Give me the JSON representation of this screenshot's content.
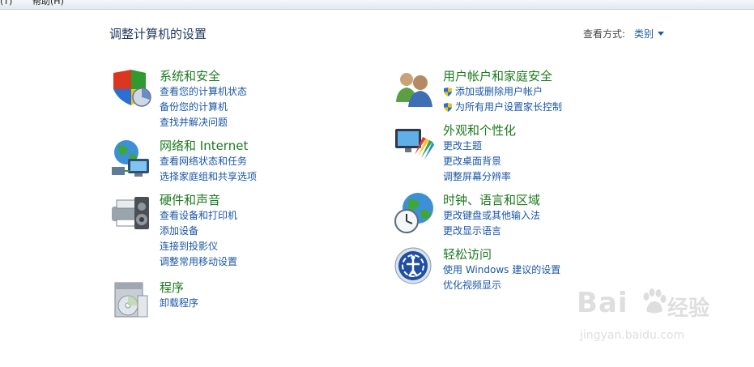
{
  "menubar": {
    "items": [
      "(T)",
      "帮助(H)"
    ]
  },
  "header": {
    "title": "调整计算机的设置",
    "view_label": "查看方式:",
    "view_value": "类别"
  },
  "categories": [
    {
      "title": "系统和安全",
      "icon": "system-security-icon",
      "links": [
        "查看您的计算机状态",
        "备份您的计算机",
        "查找并解决问题"
      ]
    },
    {
      "title": "网络和 Internet",
      "icon": "network-icon",
      "links": [
        "查看网络状态和任务",
        "选择家庭组和共享选项"
      ]
    },
    {
      "title": "硬件和声音",
      "icon": "hardware-sound-icon",
      "links": [
        "查看设备和打印机",
        "添加设备",
        "连接到投影仪",
        "调整常用移动设置"
      ]
    },
    {
      "title": "程序",
      "icon": "programs-icon",
      "links": [
        "卸载程序"
      ]
    },
    {
      "title": "用户帐户和家庭安全",
      "icon": "user-accounts-icon",
      "links": [
        "添加或删除用户帐户",
        "为所有用户设置家长控制"
      ]
    },
    {
      "title": "外观和个性化",
      "icon": "appearance-icon",
      "links": [
        "更改主题",
        "更改桌面背景",
        "调整屏幕分辨率"
      ]
    },
    {
      "title": "时钟、语言和区域",
      "icon": "clock-language-region-icon",
      "links": [
        "更改键盘或其他输入法",
        "更改显示语言"
      ]
    },
    {
      "title": "轻松访问",
      "icon": "ease-of-access-icon",
      "links": [
        "使用 Windows 建议的设置",
        "优化视频显示"
      ]
    }
  ],
  "watermark": {
    "brand": "Bai",
    "suffix": "经验",
    "url": "jingyan.baidu.com"
  },
  "colors": {
    "title": "#1e395b",
    "category": "#1c7a1e",
    "link": "#1a56a6"
  }
}
